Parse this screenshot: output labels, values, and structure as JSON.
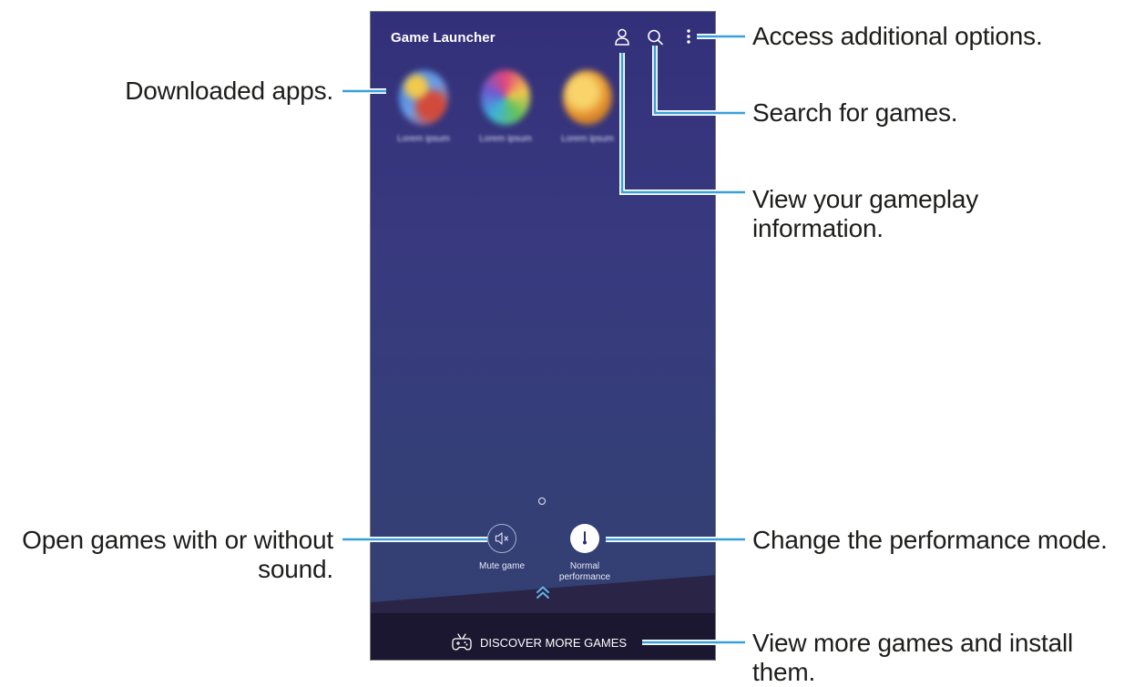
{
  "phone": {
    "app_title": "Game Launcher",
    "icons": [
      "profile-icon",
      "search-icon",
      "more-options-icon"
    ],
    "apps": [
      {
        "label": "Lorem ipsum",
        "colors": [
          "#d24a3a",
          "#3d7fd8",
          "#f2c94c"
        ]
      },
      {
        "label": "Lorem ipsum",
        "colors": [
          "#e3457b",
          "#3db4d9",
          "#63c35b"
        ]
      },
      {
        "label": "Lorem ipsum",
        "colors": [
          "#f4c046",
          "#e48f2c",
          "#b9742e"
        ]
      }
    ],
    "quick_actions": {
      "mute_label": "Mute game",
      "performance_label_line1": "Normal",
      "performance_label_line2": "performance"
    },
    "discover_label": "DISCOVER MORE GAMES"
  },
  "annotations": {
    "more_options": "Access additional options.",
    "downloaded_apps": "Downloaded apps.",
    "search": "Search for games.",
    "gameplay_info_line1": "View your gameplay",
    "gameplay_info_line2": "information.",
    "mute_line1": "Open games with or without",
    "mute_line2": "sound.",
    "performance": "Change the performance mode.",
    "discover_line1": "View more games and install",
    "discover_line2": "them."
  },
  "colors": {
    "screen_bg": "#36387c",
    "accent_line": "#3aa0d8",
    "chevron": "#5fb4ea",
    "bottom_bar": "#1b1730"
  }
}
